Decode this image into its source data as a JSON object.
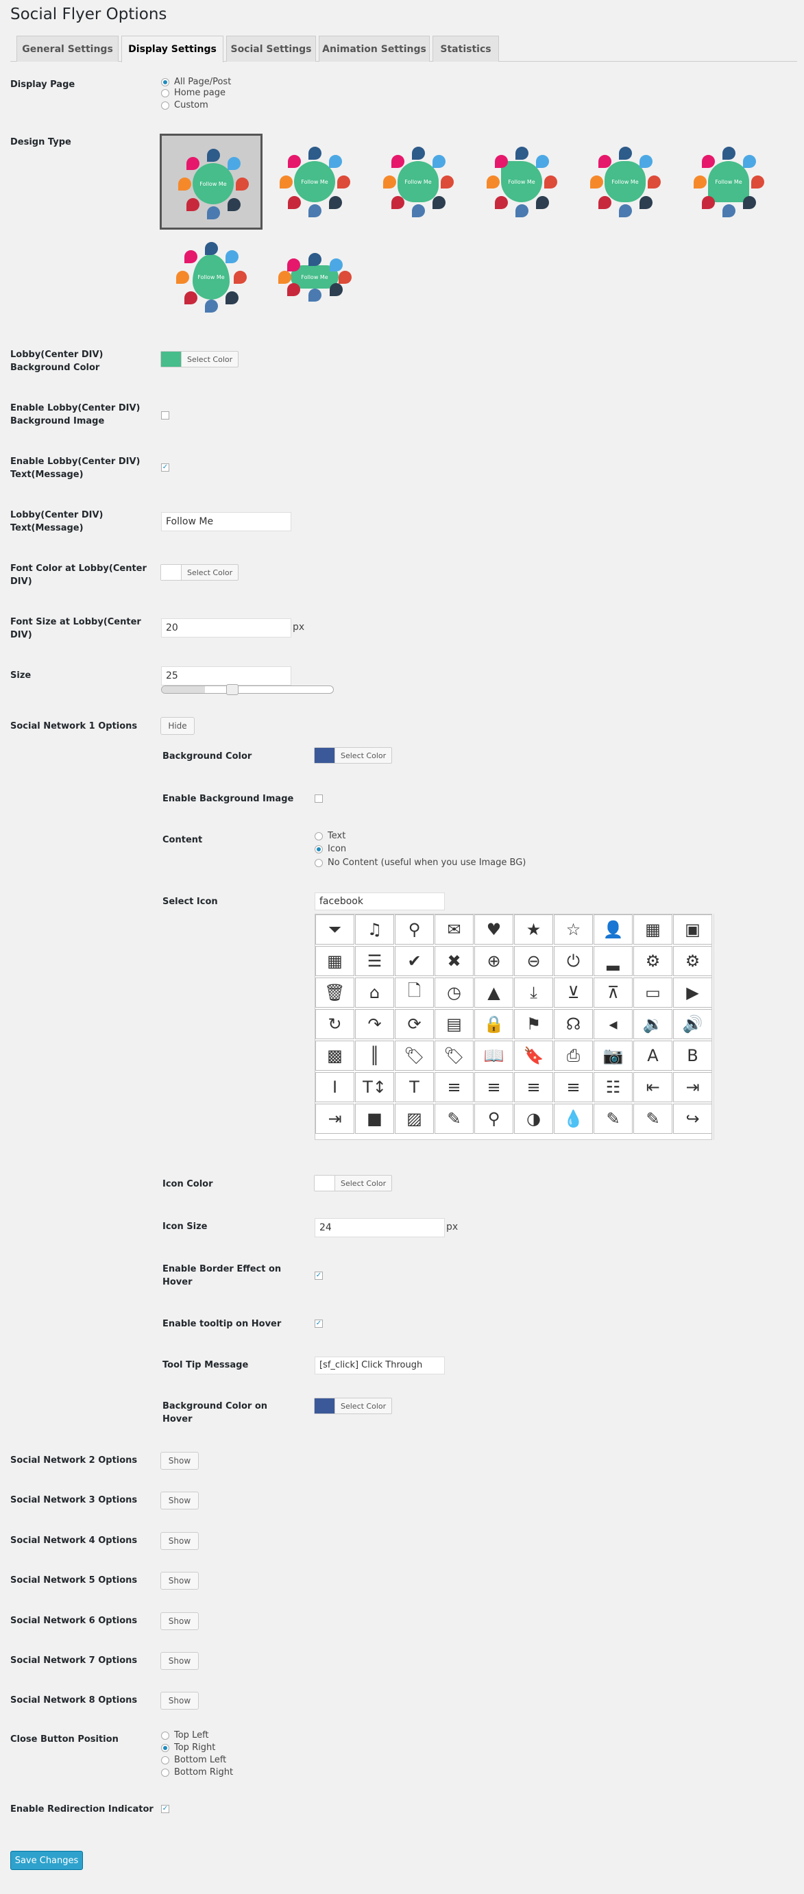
{
  "page_title": "Social Flyer Options",
  "tabs": [
    {
      "label": "General Settings",
      "active": false
    },
    {
      "label": "Display Settings",
      "active": true
    },
    {
      "label": "Social Settings",
      "active": false
    },
    {
      "label": "Animation Settings",
      "active": false
    },
    {
      "label": "Statistics",
      "active": false
    }
  ],
  "display_page": {
    "label": "Display Page",
    "options": [
      "All Page/Post",
      "Home page",
      "Custom"
    ],
    "selected": "All Page/Post"
  },
  "design_type": {
    "label": "Design Type",
    "center_text": "Follow Me",
    "selected_index": 0,
    "bubble_colors": [
      "#2d5b8a",
      "#4ca8e4",
      "#dd4b39",
      "#2c3e50",
      "#4a7ab0",
      "#c8283b",
      "#f5892a",
      "#e6186b"
    ]
  },
  "lobby_bg": {
    "label": "Lobby(Center DIV) Background Color",
    "color": "#46bd8a",
    "button": "Select Color"
  },
  "lobby_bg_image": {
    "label": "Enable Lobby(Center DIV) Background Image",
    "checked": false
  },
  "lobby_text_enable": {
    "label": "Enable Lobby(Center DIV) Text(Message)",
    "checked": true
  },
  "lobby_text": {
    "label": "Lobby(Center DIV) Text(Message)",
    "value": "Follow Me"
  },
  "lobby_font_color": {
    "label": "Font Color at Lobby(Center DIV)",
    "color": "#ffffff",
    "button": "Select Color"
  },
  "lobby_font_size": {
    "label": "Font Size at Lobby(Center DIV)",
    "value": "20",
    "unit": "px"
  },
  "size": {
    "label": "Size",
    "value": "25",
    "slider_fraction": 0.25
  },
  "network1": {
    "label": "Social Network 1 Options",
    "toggle": "Hide",
    "bg_color": {
      "label": "Background Color",
      "color": "#3b5998",
      "button": "Select Color"
    },
    "bg_image": {
      "label": "Enable Background Image",
      "checked": false
    },
    "content": {
      "label": "Content",
      "options": [
        "Text",
        "Icon",
        "No Content (useful when you use Image BG)"
      ],
      "selected": "Icon"
    },
    "select_icon": {
      "label": "Select Icon",
      "value": "facebook"
    },
    "icon_color": {
      "label": "Icon Color",
      "color": "#ffffff",
      "button": "Select Color"
    },
    "icon_size": {
      "label": "Icon Size",
      "value": "24",
      "unit": "px"
    },
    "border_effect": {
      "label": "Enable Border Effect on Hover",
      "checked": true
    },
    "tooltip": {
      "label": "Enable tooltip on Hover",
      "checked": true
    },
    "tooltip_msg": {
      "label": "Tool Tip Message",
      "value": "[sf_click] Click Through"
    },
    "hover_color": {
      "label": "Background Color on Hover",
      "color": "#3b5998",
      "button": "Select Color"
    }
  },
  "icons": [
    [
      "filter-icon",
      "music-icon",
      "search-icon",
      "envelope-icon",
      "heart-icon",
      "star-icon",
      "star-empty-icon",
      "user-icon",
      "film-icon",
      "th-large-icon"
    ],
    [
      "th-icon",
      "th-list-icon",
      "check-icon",
      "close-icon",
      "zoom-in-icon",
      "zoom-out-icon",
      "power-icon",
      "signal-icon",
      "cog-icon",
      "gear-icon"
    ],
    [
      "trash-icon",
      "home-icon",
      "file-icon",
      "clock-icon",
      "road-icon",
      "download-icon",
      "download-circle-icon",
      "upload-circle-icon",
      "inbox-icon",
      "play-circle-icon"
    ],
    [
      "repeat-icon",
      "redo-icon",
      "refresh-icon",
      "list-alt-icon",
      "lock-icon",
      "flag-icon",
      "headphones-icon",
      "volume-off-icon",
      "volume-down-icon",
      "volume-up-icon"
    ],
    [
      "qrcode-icon",
      "barcode-icon",
      "tag-icon",
      "tags-icon",
      "book-icon",
      "bookmark-icon",
      "print-icon",
      "camera-icon",
      "font-icon",
      "bold-icon"
    ],
    [
      "italic-icon",
      "text-height-icon",
      "text-width-icon",
      "align-left-icon",
      "align-center-icon",
      "align-right-icon",
      "align-justify-icon",
      "list-icon",
      "indent-left-icon",
      "indent-right-icon"
    ],
    [
      "indent-icon",
      "video-icon",
      "picture-icon",
      "pencil-icon",
      "map-marker-icon",
      "contrast-icon",
      "tint-icon",
      "edit-icon",
      "edit-square-icon",
      "share-icon"
    ]
  ],
  "icon_glyphs": [
    [
      "⏷",
      "♫",
      "⚲",
      "✉",
      "♥",
      "★",
      "☆",
      "👤",
      "▦",
      "▣"
    ],
    [
      "▦",
      "☰",
      "✔",
      "✖",
      "⊕",
      "⊖",
      "⏻",
      "▂",
      "⚙",
      "⚙"
    ],
    [
      "🗑",
      "⌂",
      "🗋",
      "◷",
      "▲",
      "⤓",
      "⊻",
      "⊼",
      "▭",
      "▶"
    ],
    [
      "↻",
      "↷",
      "⟳",
      "▤",
      "🔒",
      "⚑",
      "☊",
      "◂",
      "🔉",
      "🔊"
    ],
    [
      "▩",
      "║",
      "🏷",
      "🏷",
      "📖",
      "🔖",
      "⎙",
      "📷",
      "A",
      "B"
    ],
    [
      "I",
      "T↕",
      "T",
      "≡",
      "≡",
      "≡",
      "≡",
      "☷",
      "⇤",
      "⇥"
    ],
    [
      "⇥",
      "■",
      "▨",
      "✎",
      "⚲",
      "◑",
      "💧",
      "✎",
      "✎",
      "↪"
    ]
  ],
  "other_networks": [
    {
      "label": "Social Network 2 Options",
      "toggle": "Show"
    },
    {
      "label": "Social Network 3 Options",
      "toggle": "Show"
    },
    {
      "label": "Social Network 4 Options",
      "toggle": "Show"
    },
    {
      "label": "Social Network 5 Options",
      "toggle": "Show"
    },
    {
      "label": "Social Network 6 Options",
      "toggle": "Show"
    },
    {
      "label": "Social Network 7 Options",
      "toggle": "Show"
    },
    {
      "label": "Social Network 8 Options",
      "toggle": "Show"
    }
  ],
  "close_button": {
    "label": "Close Button Position",
    "options": [
      "Top Left",
      "Top Right",
      "Bottom Left",
      "Bottom Right"
    ],
    "selected": "Top Right"
  },
  "redirect": {
    "label": "Enable Redirection Indicator",
    "checked": true
  },
  "save_label": "Save Changes"
}
